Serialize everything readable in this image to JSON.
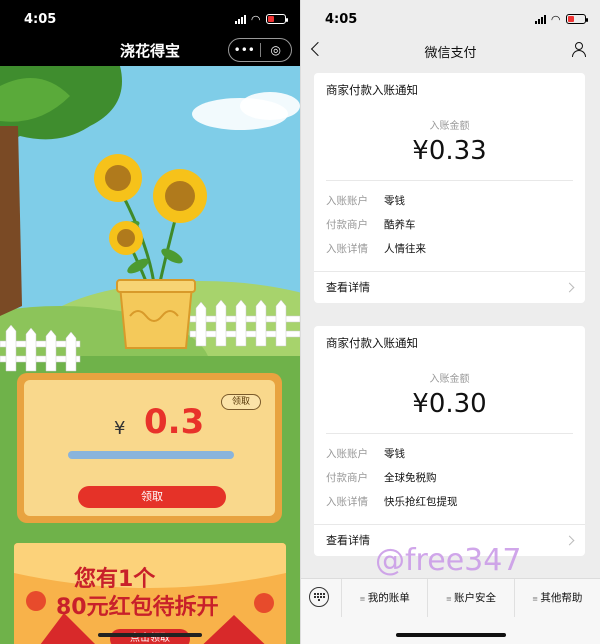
{
  "left": {
    "status": {
      "time": "4:05"
    },
    "nav": {
      "title": "浇花得宝",
      "menu_glyph": "•••",
      "target_glyph": "◎"
    },
    "card": {
      "currency": "¥",
      "amount": "0.3",
      "small_button": "领取",
      "claim_button": "领取",
      "progress": 0.9
    },
    "promo": {
      "line1": "您有1个",
      "line2": "80元红包待拆开",
      "tap": "点击领取"
    }
  },
  "right": {
    "status": {
      "time": "4:05"
    },
    "nav": {
      "title": "微信支付"
    },
    "notices": [
      {
        "title": "商家付款入账通知",
        "amount_label": "入账金额",
        "amount": "¥0.33",
        "rows": [
          {
            "key": "入账账户",
            "value": "零钱"
          },
          {
            "key": "付款商户",
            "value": "酷养车"
          },
          {
            "key": "入账详情",
            "value": "人情往来"
          }
        ],
        "footer": "查看详情"
      },
      {
        "title": "商家付款入账通知",
        "amount_label": "入账金额",
        "amount": "¥0.30",
        "rows": [
          {
            "key": "入账账户",
            "value": "零钱"
          },
          {
            "key": "付款商户",
            "value": "全球免税购"
          },
          {
            "key": "入账详情",
            "value": "快乐抢红包提现"
          }
        ],
        "footer": "查看详情"
      }
    ],
    "bottom_menu": [
      "我的账单",
      "账户安全",
      "其他帮助"
    ]
  },
  "watermark": "@free347"
}
